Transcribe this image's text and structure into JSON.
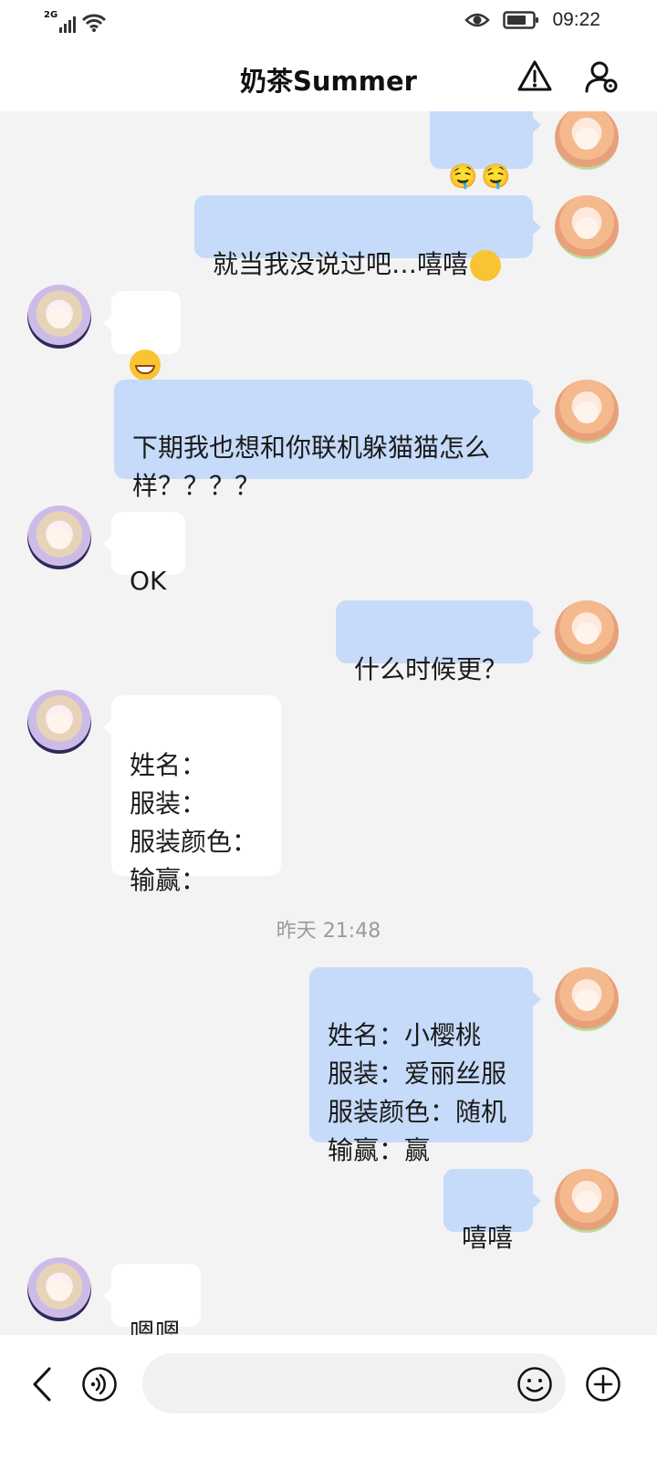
{
  "status_bar": {
    "network": "2G",
    "time": "09:22"
  },
  "header": {
    "title": "奶茶Summer"
  },
  "messages": [
    {
      "side": "me",
      "text": ""
    },
    {
      "side": "me",
      "text": "就当我没说过吧…嘻嘻"
    },
    {
      "side": "them",
      "text": ""
    },
    {
      "side": "me",
      "text": "下期我也想和你联机躲猫猫怎么\n样？？？？"
    },
    {
      "side": "them",
      "text": "OK"
    },
    {
      "side": "me",
      "text": "什么时候更？"
    },
    {
      "side": "them",
      "text": "姓名：\n服装：\n服装颜色：\n输赢："
    },
    {
      "side": "me",
      "text": "姓名：小樱桃\n服装：爱丽丝服\n服装颜色：随机\n输赢：赢"
    },
    {
      "side": "me",
      "text": "嘻嘻"
    },
    {
      "side": "them",
      "text": "嗯嗯"
    }
  ],
  "timestamp": "昨天 21:48",
  "colors": {
    "my_bubble": "#c6daf9",
    "their_bubble": "#ffffff",
    "background": "#f3f3f3"
  },
  "icons": {
    "back": "chevron-left-icon",
    "voice": "voice-icon",
    "emoji": "emoji-icon",
    "add": "plus-circle-icon",
    "report": "warning-icon",
    "settings": "user-settings-icon"
  }
}
